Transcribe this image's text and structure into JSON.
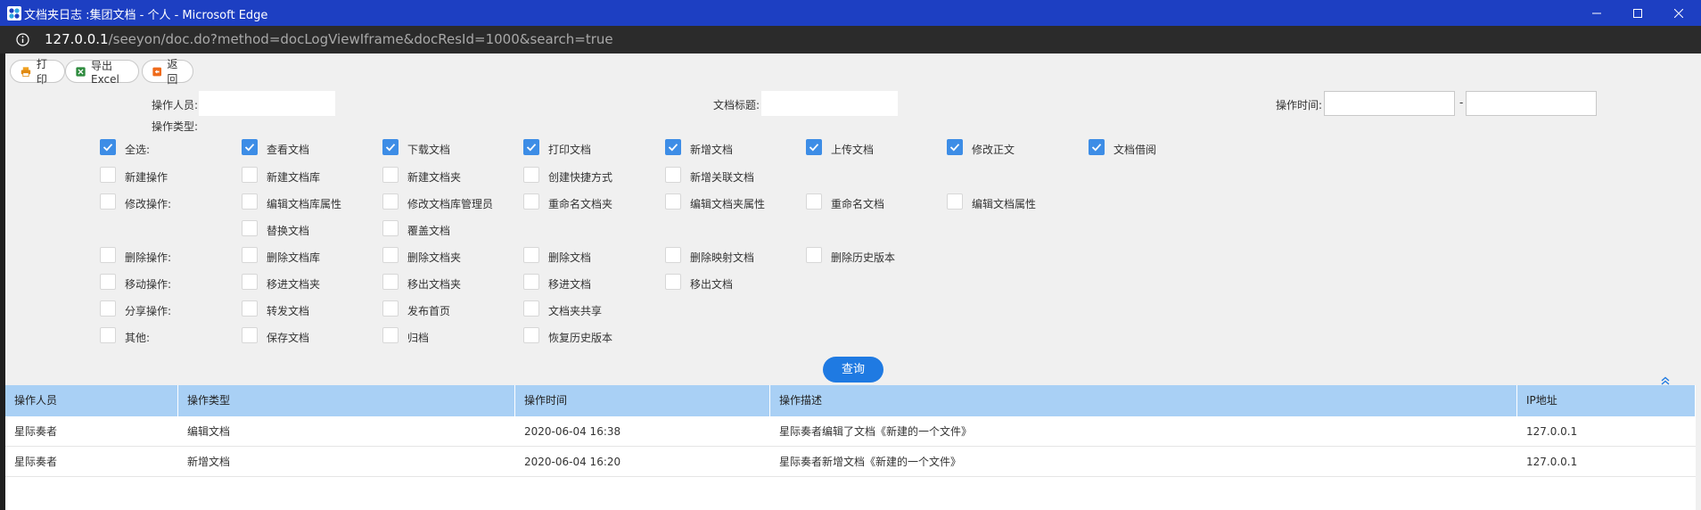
{
  "window": {
    "title": "文档夹日志 :集团文档 - 个人 - Microsoft Edge"
  },
  "address": {
    "host": "127.0.0.1",
    "path": "/seeyon/doc.do?method=docLogViewIframe&docResId=1000&search=true"
  },
  "toolbar": {
    "print_label": "打印",
    "export_label": "导出Excel",
    "back_label": "返回"
  },
  "filters": {
    "operator_label": "操作人员:",
    "operator_value": "",
    "doc_title_label": "文档标题:",
    "doc_title_value": "",
    "op_time_label": "操作时间:",
    "op_time_from": "",
    "op_time_sep": "-",
    "op_time_to": "",
    "op_type_label": "操作类型:"
  },
  "op_types": {
    "row1": [
      {
        "label": "全选:",
        "checked": true
      },
      {
        "label": "查看文档",
        "checked": true
      },
      {
        "label": "下载文档",
        "checked": true
      },
      {
        "label": "打印文档",
        "checked": true
      },
      {
        "label": "新增文档",
        "checked": true
      },
      {
        "label": "上传文档",
        "checked": true
      },
      {
        "label": "修改正文",
        "checked": true
      },
      {
        "label": "文档借阅",
        "checked": true
      }
    ],
    "row2": [
      {
        "label": "新建操作",
        "checked": false
      },
      {
        "label": "新建文档库",
        "checked": false
      },
      {
        "label": "新建文档夹",
        "checked": false
      },
      {
        "label": "创建快捷方式",
        "checked": false
      },
      {
        "label": "新增关联文档",
        "checked": false
      }
    ],
    "row3": [
      {
        "label": "修改操作:",
        "checked": false
      },
      {
        "label": "编辑文档库属性",
        "checked": false
      },
      {
        "label": "修改文档库管理员",
        "checked": false
      },
      {
        "label": "重命名文档夹",
        "checked": false
      },
      {
        "label": "编辑文档夹属性",
        "checked": false
      },
      {
        "label": "重命名文档",
        "checked": false
      },
      {
        "label": "编辑文档属性",
        "checked": false
      }
    ],
    "row4": [
      {
        "label": "替换文档",
        "checked": false
      },
      {
        "label": "覆盖文档",
        "checked": false
      }
    ],
    "row5": [
      {
        "label": "删除操作:",
        "checked": false
      },
      {
        "label": "删除文档库",
        "checked": false
      },
      {
        "label": "删除文档夹",
        "checked": false
      },
      {
        "label": "删除文档",
        "checked": false
      },
      {
        "label": "删除映射文档",
        "checked": false
      },
      {
        "label": "删除历史版本",
        "checked": false
      }
    ],
    "row6": [
      {
        "label": "移动操作:",
        "checked": false
      },
      {
        "label": "移进文档夹",
        "checked": false
      },
      {
        "label": "移出文档夹",
        "checked": false
      },
      {
        "label": "移进文档",
        "checked": false
      },
      {
        "label": "移出文档",
        "checked": false
      }
    ],
    "row7": [
      {
        "label": "分享操作:",
        "checked": false
      },
      {
        "label": "转发文档",
        "checked": false
      },
      {
        "label": "发布首页",
        "checked": false
      },
      {
        "label": "文档夹共享",
        "checked": false
      }
    ],
    "row8": [
      {
        "label": "其他:",
        "checked": false
      },
      {
        "label": "保存文档",
        "checked": false
      },
      {
        "label": "归档",
        "checked": false
      },
      {
        "label": "恢复历史版本",
        "checked": false
      }
    ]
  },
  "query_label": "查询",
  "grid": {
    "headers": [
      "操作人员",
      "操作类型",
      "操作时间",
      "操作描述",
      "IP地址"
    ],
    "rows": [
      [
        "星际奏者",
        "编辑文档",
        "2020-06-04 16:38",
        "星际奏者编辑了文档《新建的一个文件》",
        "127.0.0.1"
      ],
      [
        "星际奏者",
        "新增文档",
        "2020-06-04 16:20",
        "星际奏者新增文档《新建的一个文件》",
        "127.0.0.1"
      ]
    ]
  },
  "colors": {
    "titlebar": "#1d3fc2",
    "accent": "#1f7ae2",
    "checkbox_checked": "#3d8de6",
    "grid_header": "#a9d0f5"
  }
}
